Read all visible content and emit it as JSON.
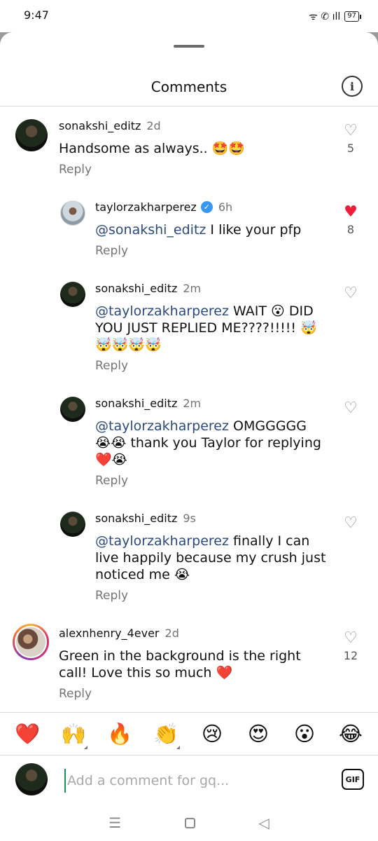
{
  "status_bar": {
    "time": "9:47",
    "signal_icons": "ᯤ ✆ ıll",
    "battery": "97"
  },
  "header": {
    "title": "Comments",
    "info_icon": "i"
  },
  "comments": [
    {
      "username": "sonakshi_editz",
      "time": "2d",
      "text": "Handsome as always.. 🤩🤩",
      "reply_label": "Reply",
      "likes": "5",
      "liked": false
    },
    {
      "username": "taylorzakharperez",
      "verified": true,
      "time": "6h",
      "mention": "@sonakshi_editz",
      "text": " I like your pfp",
      "reply_label": "Reply",
      "likes": "8",
      "liked": true
    },
    {
      "username": "sonakshi_editz",
      "time": "2m",
      "mention": "@taylorzakharperez",
      "text": " WAIT 😮 DID YOU JUST REPLIED ME????!!!!! 🤯🤯🤯🤯🤯",
      "reply_label": "Reply",
      "liked": false
    },
    {
      "username": "sonakshi_editz",
      "time": "2m",
      "mention": "@taylorzakharperez",
      "text": " OMGGGGG 😭😭 thank you Taylor for replying ❤️😭",
      "reply_label": "Reply",
      "liked": false
    },
    {
      "username": "sonakshi_editz",
      "time": "9s",
      "mention": "@taylorzakharperez",
      "text": " finally I can live happily because my crush just noticed me 😭",
      "reply_label": "Reply",
      "liked": false
    },
    {
      "username": "alexnhenry_4ever",
      "time": "2d",
      "text": "Green in the background is the right call! Love this so much ❤️",
      "reply_label": "Reply",
      "likes": "12",
      "liked": false
    }
  ],
  "like_icon": "heart-icon",
  "quick_reactions": [
    "❤️",
    "🙌",
    "🔥",
    "👏",
    "😢",
    "😍",
    "😮",
    "😂"
  ],
  "composer": {
    "placeholder": "Add a comment for gq...",
    "gif_label": "GIF"
  },
  "nav": {
    "menu_glyph": "☰",
    "back_glyph": "◁"
  }
}
